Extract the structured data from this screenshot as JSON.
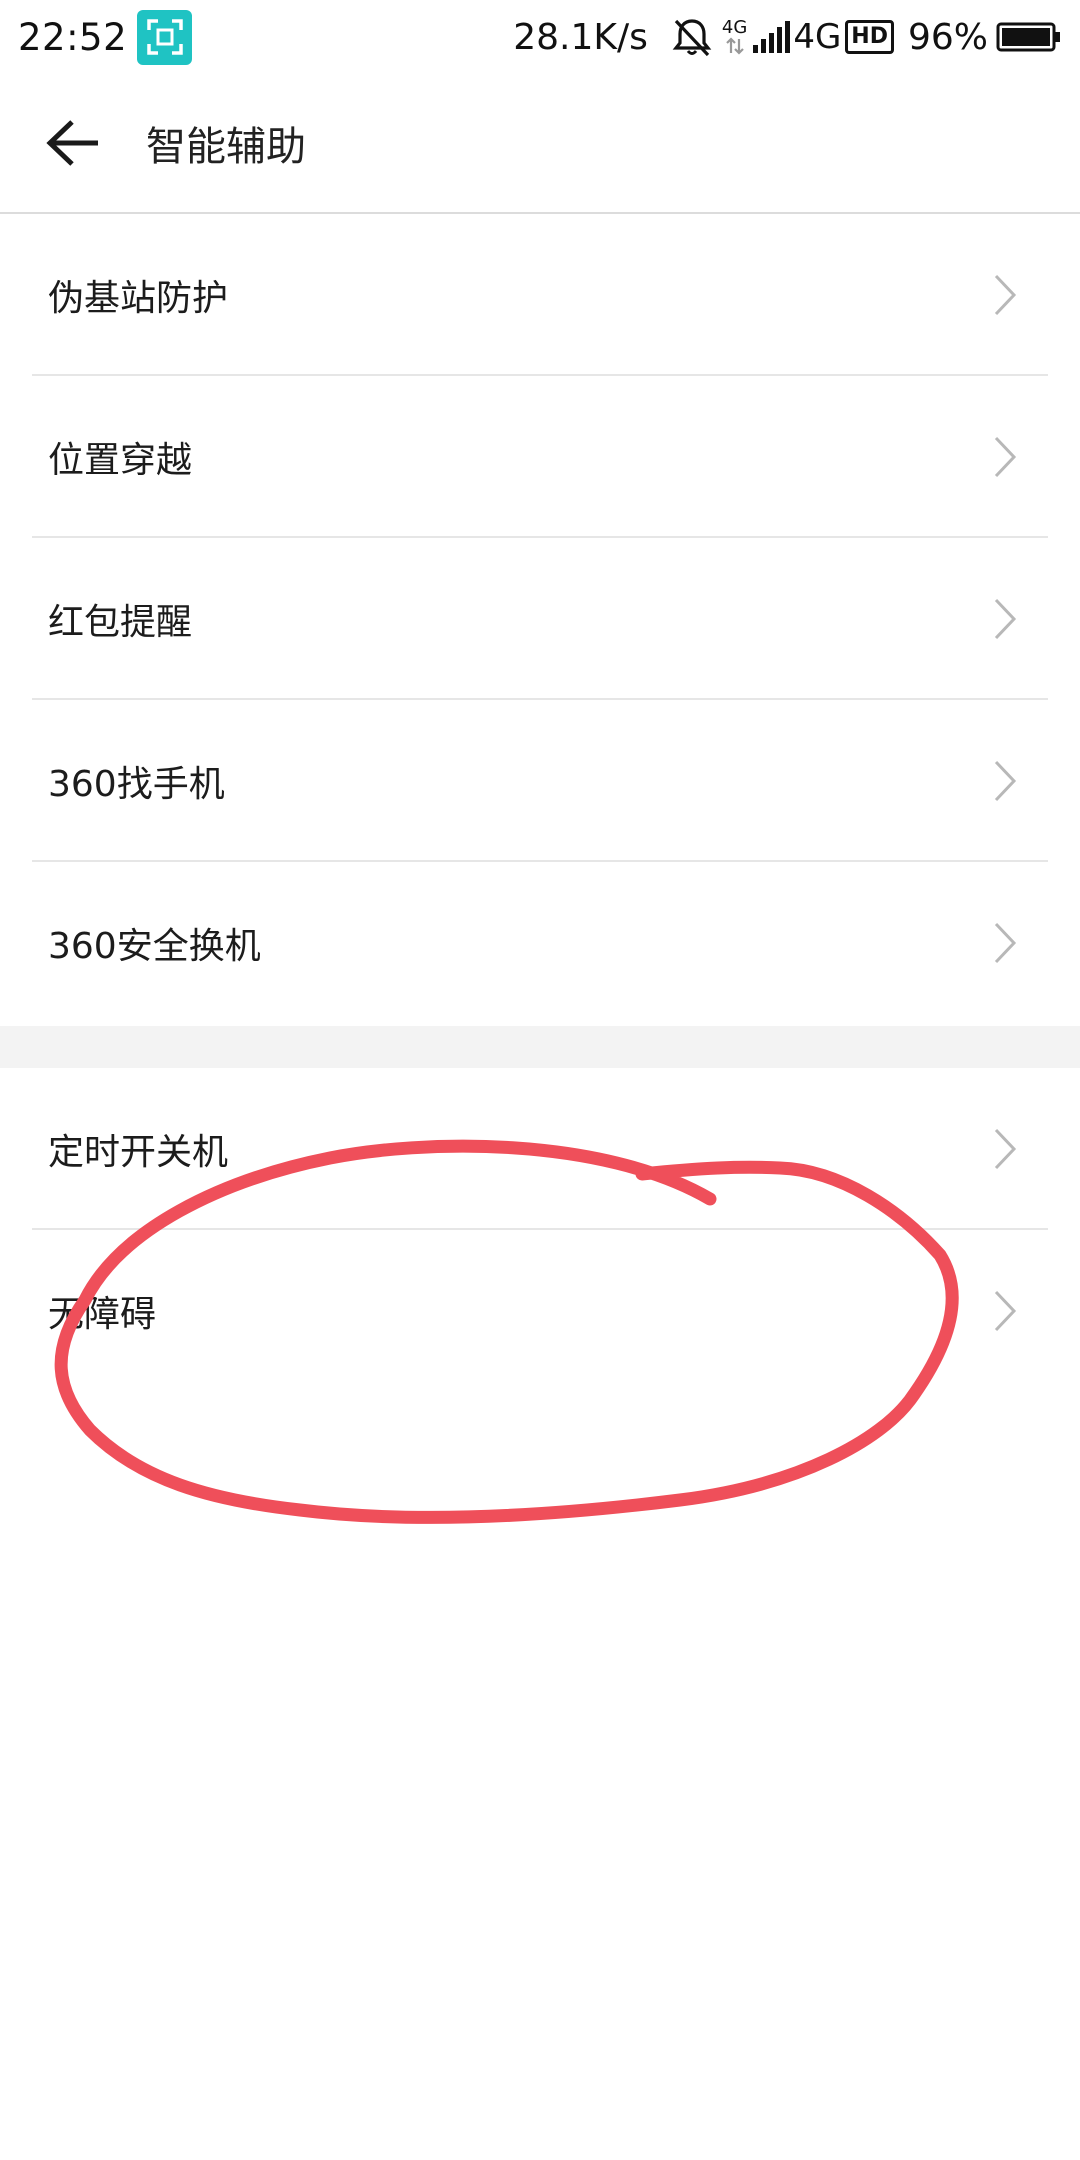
{
  "status_bar": {
    "time": "22:52",
    "net_speed": "28.1K/s",
    "net_type_small": "4G",
    "net_type": "4G",
    "hd_label": "HD",
    "battery": "96%"
  },
  "header": {
    "title": "智能辅助"
  },
  "section1": {
    "items": [
      {
        "label": "伪基站防护"
      },
      {
        "label": "位置穿越"
      },
      {
        "label": "红包提醒"
      },
      {
        "label": "360找手机"
      },
      {
        "label": "360安全换机"
      }
    ]
  },
  "section2": {
    "items": [
      {
        "label": "定时开关机"
      },
      {
        "label": "无障碍"
      }
    ]
  },
  "colors": {
    "accent_badge": "#1fc3c3",
    "annotation": "#ef4f5a",
    "chevron": "#b8b8b8",
    "divider": "#e6e6e6"
  }
}
